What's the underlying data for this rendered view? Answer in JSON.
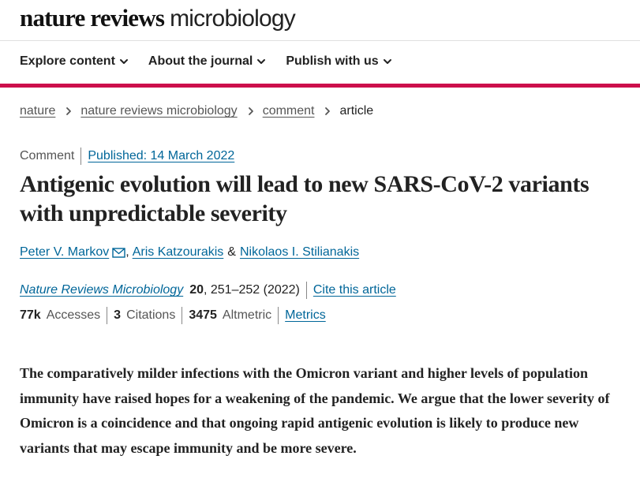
{
  "brand": {
    "bold": "nature reviews",
    "light": "microbiology"
  },
  "nav": {
    "items": [
      {
        "label": "Explore content"
      },
      {
        "label": "About the journal"
      },
      {
        "label": "Publish with us"
      }
    ]
  },
  "breadcrumb": {
    "items": [
      {
        "label": "nature"
      },
      {
        "label": "nature reviews microbiology"
      },
      {
        "label": "comment"
      }
    ],
    "current": "article"
  },
  "article": {
    "type": "Comment",
    "published": "Published: 14 March 2022",
    "title": "Antigenic evolution will lead to new SARS-CoV-2 variants with unpredictable severity",
    "authors": [
      "Peter V. Markov",
      "Aris Katzourakis",
      "Nikolaos I. Stilianakis"
    ],
    "author_sep_1": ",",
    "author_sep_2": "&",
    "journal": "Nature Reviews Microbiology",
    "volume": "20",
    "pages": ", 251–252 (2022)",
    "cite_label": "Cite this article",
    "metrics": {
      "accesses_value": "77k",
      "accesses_label": "Accesses",
      "citations_value": "3",
      "citations_label": "Citations",
      "altmetric_value": "3475",
      "altmetric_label": "Altmetric",
      "metrics_link": "Metrics"
    },
    "abstract": "The comparatively milder infections with the Omicron variant and higher levels of population immunity have raised hopes for a weakening of the pandemic. We argue that the lower severity of Omicron is a coincidence and that ongoing rapid antigenic evolution is likely to produce new variants that may escape immunity and be more severe."
  },
  "colors": {
    "accent": "#cc0f4b",
    "link": "#006699",
    "text": "#222222",
    "muted": "#555555"
  },
  "icons": {
    "nav_dropdown": "chevron-down-icon",
    "breadcrumb_separator": "chevron-right-icon",
    "author_contact": "mail-icon"
  }
}
